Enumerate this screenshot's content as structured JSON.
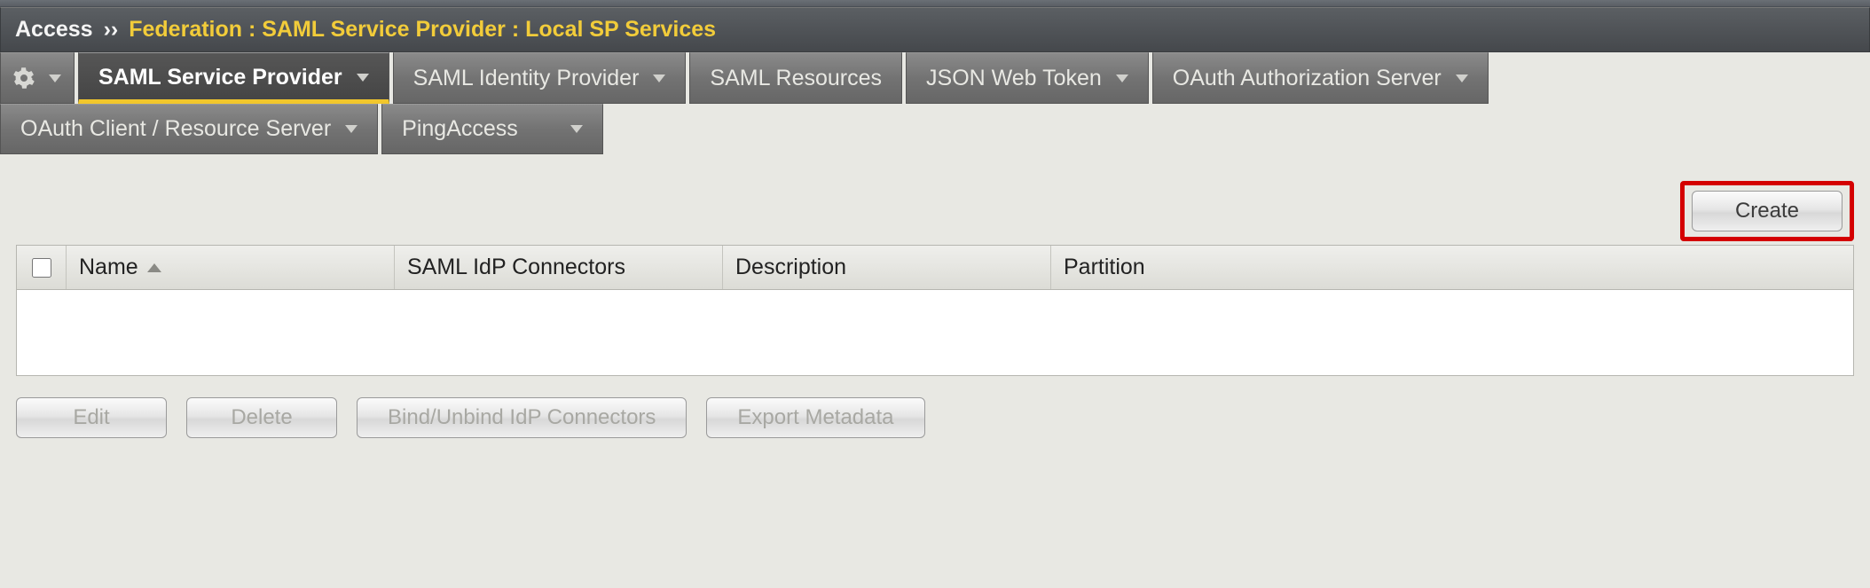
{
  "breadcrumb": {
    "root": "Access",
    "separator": "››",
    "path": "Federation : SAML Service Provider : Local SP Services"
  },
  "tabs_row1": [
    {
      "id": "gear",
      "label": "",
      "hasCaret": true,
      "isGear": true
    },
    {
      "id": "saml-sp",
      "label": "SAML Service Provider",
      "hasCaret": true,
      "active": true
    },
    {
      "id": "saml-idp",
      "label": "SAML Identity Provider",
      "hasCaret": true
    },
    {
      "id": "saml-res",
      "label": "SAML Resources",
      "hasCaret": false
    },
    {
      "id": "jwt",
      "label": "JSON Web Token",
      "hasCaret": true
    },
    {
      "id": "oauth-auth",
      "label": "OAuth Authorization Server",
      "hasCaret": true
    }
  ],
  "tabs_row2": [
    {
      "id": "oauth-client",
      "label": "OAuth Client / Resource Server",
      "hasCaret": true
    },
    {
      "id": "pingaccess",
      "label": "PingAccess",
      "hasCaret": true
    }
  ],
  "buttons": {
    "create": "Create",
    "edit": "Edit",
    "delete": "Delete",
    "bind": "Bind/Unbind IdP Connectors",
    "export": "Export Metadata"
  },
  "columns": {
    "name": "Name",
    "connectors": "SAML IdP Connectors",
    "description": "Description",
    "partition": "Partition"
  }
}
